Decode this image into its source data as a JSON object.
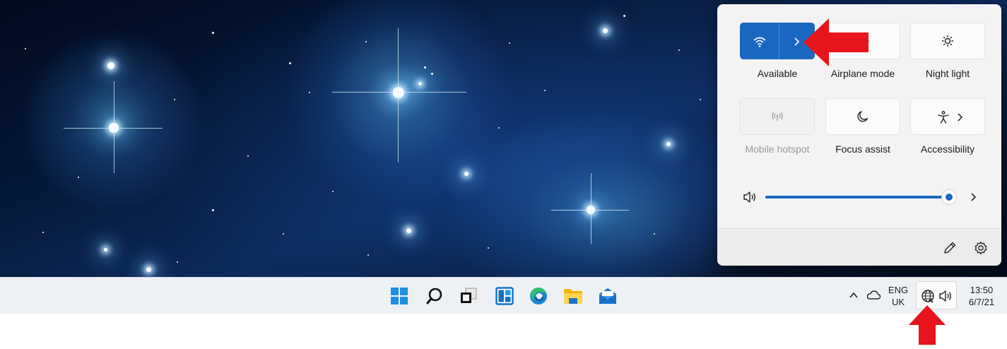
{
  "quick_settings": {
    "tiles": [
      {
        "label": "Available",
        "icon": "wifi-icon",
        "state": "on"
      },
      {
        "label": "Airplane mode",
        "icon": "airplane-icon",
        "state": "off"
      },
      {
        "label": "Night light",
        "icon": "brightness-icon",
        "state": "off"
      },
      {
        "label": "Mobile hotspot",
        "icon": "hotspot-icon",
        "state": "disabled"
      },
      {
        "label": "Focus assist",
        "icon": "moon-icon",
        "state": "off"
      },
      {
        "label": "Accessibility",
        "icon": "accessibility-icon",
        "state": "off"
      }
    ],
    "volume_level": 1.0,
    "footer_icons": [
      "pencil-icon",
      "gear-icon"
    ]
  },
  "taskbar": {
    "apps": [
      "start-icon",
      "search-icon",
      "task-view-icon",
      "widgets-icon",
      "edge-icon",
      "file-explorer-icon",
      "mail-icon"
    ],
    "tray": {
      "language_line1": "ENG",
      "language_line2": "UK",
      "time": "13:50",
      "date": "6/7/21"
    }
  },
  "colors": {
    "accent": "#1a67c2",
    "annotation_arrow": "#e8141b",
    "taskbar_bg": "#eef1f4",
    "panel_bg": "#f3f3f3"
  }
}
